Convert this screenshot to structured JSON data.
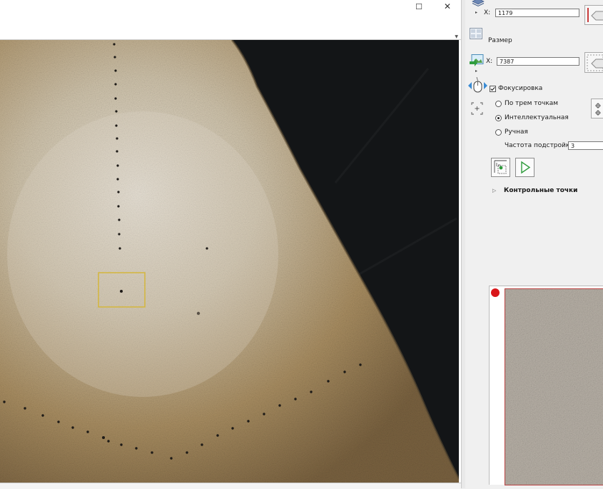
{
  "window": {
    "maximize_glyph": "☐",
    "close_glyph": "✕"
  },
  "viewer": {
    "icon": "sample-image",
    "selection_color": "#d4b63c"
  },
  "panel": {
    "position": {
      "x_label": "X:",
      "x_value": "1179"
    },
    "size": {
      "label": "Размер"
    },
    "scan": {
      "x_label": "X:",
      "x_value": "7387"
    },
    "focus": {
      "checkbox_label": "Фокусировка",
      "checked": true,
      "options": [
        {
          "label": "По трем точкам",
          "selected": false
        },
        {
          "label": "Интеллектуальная",
          "selected": true
        },
        {
          "label": "Ручная",
          "selected": false
        }
      ],
      "frequency_label": "Частота подстройки:",
      "frequency_value": "3"
    },
    "control_points": {
      "label": "Контрольные точки",
      "expander_glyph": "▷"
    },
    "preview": {
      "status_color": "#d9161a"
    }
  }
}
